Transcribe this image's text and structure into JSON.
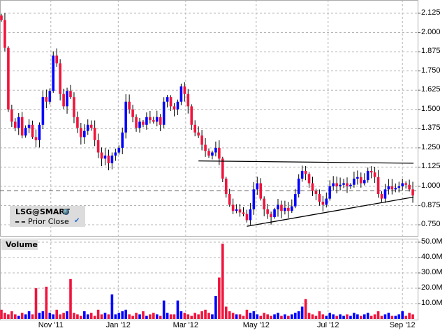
{
  "legend": {
    "symbol": "LSG@SMART",
    "prior_close_label": "Prior Close"
  },
  "volume_label": "Volume",
  "colors": {
    "up": "#0000ff",
    "down": "#f0143c",
    "grid": "#b4b4b4"
  },
  "chart_data": [
    {
      "type": "candlestick",
      "title": "LSG@SMART",
      "ylim": [
        0.7,
        2.16
      ],
      "y_ticks": [
        "2.125",
        "2.000",
        "1.875",
        "1.750",
        "1.625",
        "1.500",
        "1.375",
        "1.250",
        "1.125",
        "1.000",
        "0.875",
        "0.750"
      ],
      "y_tick_values": [
        2.125,
        2.0,
        1.875,
        1.75,
        1.625,
        1.5,
        1.375,
        1.25,
        1.125,
        1.0,
        0.875,
        0.75
      ],
      "x_labels": [
        {
          "label": "Nov '11",
          "bar": 14.3
        },
        {
          "label": "Jan '12",
          "bar": 33.8
        },
        {
          "label": "Mar '12",
          "bar": 53.3
        },
        {
          "label": "May '12",
          "bar": 73.7
        },
        {
          "label": "Jul '12",
          "bar": 94.5
        },
        {
          "label": "Sep '12",
          "bar": 116
        }
      ],
      "prior_close": 0.97,
      "trendlines": [
        {
          "from": [
            57,
            1.165
          ],
          "to": [
            119.2,
            1.15
          ]
        },
        {
          "from": [
            71,
            0.74
          ],
          "to": [
            119.2,
            0.93
          ]
        }
      ],
      "closes": [
        2.08,
        1.9,
        1.5,
        1.42,
        1.38,
        1.45,
        1.33,
        1.38,
        1.4,
        1.32,
        1.3,
        1.4,
        1.58,
        1.55,
        1.62,
        1.85,
        1.8,
        1.6,
        1.52,
        1.62,
        1.58,
        1.45,
        1.38,
        1.32,
        1.36,
        1.4,
        1.38,
        1.3,
        1.22,
        1.18,
        1.2,
        1.15,
        1.2,
        1.22,
        1.25,
        1.35,
        1.55,
        1.5,
        1.45,
        1.38,
        1.42,
        1.4,
        1.45,
        1.43,
        1.42,
        1.45,
        1.4,
        1.55,
        1.58,
        1.52,
        1.5,
        1.55,
        1.65,
        1.6,
        1.52,
        1.4,
        1.35,
        1.33,
        1.27,
        1.23,
        1.2,
        1.22,
        1.25,
        1.18,
        1.05,
        0.95,
        0.88,
        0.84,
        0.85,
        0.83,
        0.82,
        0.78,
        0.85,
        0.98,
        1.02,
        0.92,
        0.85,
        0.82,
        0.8,
        0.85,
        0.88,
        0.84,
        0.86,
        0.84,
        0.87,
        0.95,
        1.05,
        1.1,
        1.08,
        1.02,
        0.97,
        0.95,
        0.9,
        0.88,
        0.92,
        1.0,
        1.02,
        1.0,
        1.01,
        1.02,
        1.0,
        1.01,
        1.05,
        1.06,
        1.02,
        1.04,
        1.1,
        1.09,
        1.06,
        0.95,
        0.92,
        0.98,
        1.0,
        0.98,
        0.99,
        1.0,
        1.02,
        1.01,
        0.98,
        0.94
      ]
    },
    {
      "type": "bar",
      "title": "Volume",
      "ylim": [
        0,
        52
      ],
      "y_ticks": [
        "50.0M",
        "40.0M",
        "30.0M",
        "20.0M",
        "10.0M"
      ],
      "y_tick_values": [
        50,
        40,
        30,
        20,
        10
      ],
      "values_millions": [
        6,
        4,
        3,
        5,
        3,
        2,
        4,
        3,
        5,
        3,
        20,
        4,
        5,
        21,
        4,
        3,
        6,
        3,
        4,
        5,
        26,
        4,
        3,
        2,
        5,
        3,
        4,
        2,
        6,
        3,
        4,
        3,
        16,
        3,
        4,
        5,
        6,
        3,
        2,
        4,
        3,
        5,
        2,
        3,
        4,
        3,
        2,
        12,
        4,
        3,
        3,
        12,
        5,
        4,
        3,
        2,
        4,
        3,
        5,
        6,
        4,
        3,
        15,
        27,
        49,
        8,
        5,
        4,
        3,
        3,
        2,
        6,
        4,
        5,
        3,
        2,
        4,
        3,
        2,
        3,
        4,
        2,
        3,
        2,
        3,
        4,
        5,
        8,
        13,
        4,
        3,
        2,
        5,
        3,
        2,
        4,
        3,
        2,
        3,
        2,
        3,
        2,
        4,
        3,
        2,
        3,
        4,
        2,
        3,
        5,
        2,
        3,
        4,
        2,
        2,
        3,
        5,
        2,
        4,
        3
      ]
    }
  ]
}
